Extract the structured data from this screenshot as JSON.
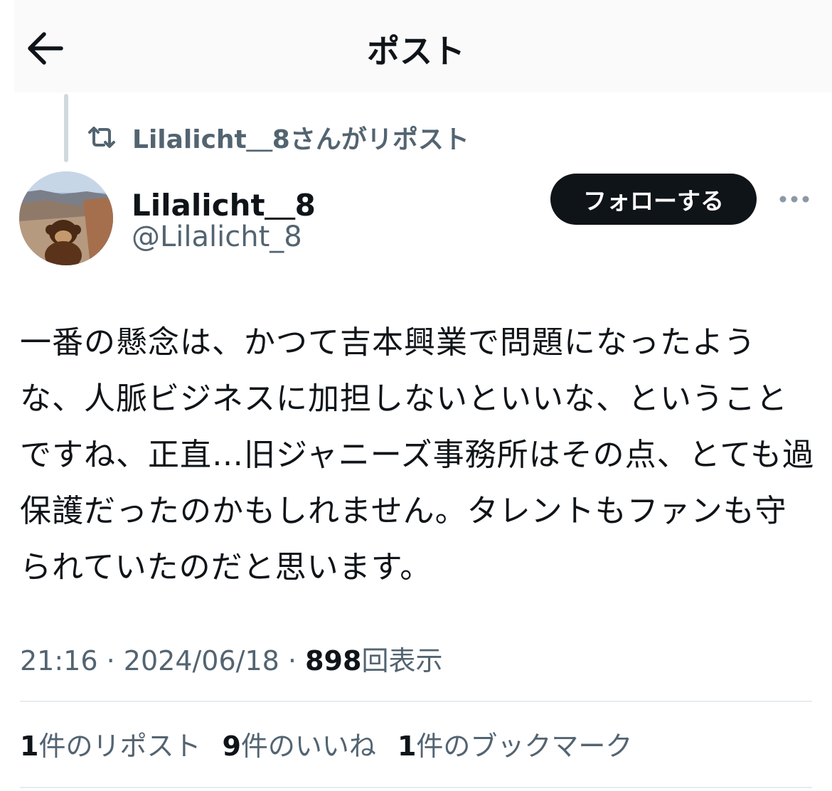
{
  "header": {
    "title": "ポスト",
    "back_icon": "arrow-left-icon"
  },
  "repost": {
    "icon": "repost-icon",
    "text": "Lilalicht＿8さんがリポスト"
  },
  "author": {
    "display_name": "Lilalicht＿8",
    "handle": "@Lilalicht_8",
    "avatar_description": "profile photo: plush monkey on canyon edge"
  },
  "actions": {
    "follow_label": "フォローする",
    "more_icon": "more-dots-icon"
  },
  "post": {
    "text": "一番の懸念は、かつて吉本興業で問題になったような、人脈ビジネスに加担しないといいな、ということですね、正直…旧ジャニーズ事務所はその点、とても過保護だったのかもしれません。タレントもファンも守られていたのだと思います。"
  },
  "meta": {
    "time": "21:16",
    "date": "2024/06/18",
    "views_count": "898",
    "views_label": "回表示",
    "separator": "·"
  },
  "stats": {
    "reposts_count": "1",
    "reposts_label": "件のリポスト",
    "likes_count": "9",
    "likes_label": "件のいいね",
    "bookmarks_count": "1",
    "bookmarks_label": "件のブックマーク"
  },
  "colors": {
    "text": "#0f1419",
    "secondary": "#536471",
    "button": "#0f1419",
    "border": "#e6ecf0"
  }
}
